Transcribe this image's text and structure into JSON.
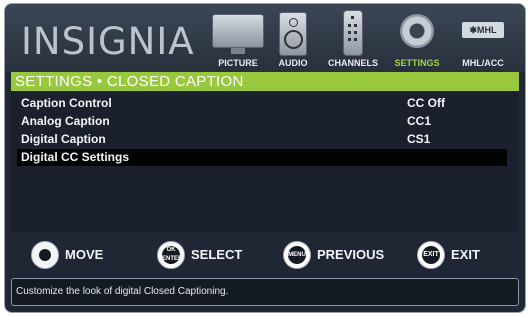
{
  "brand": {
    "logo_text": "INSIGNIA"
  },
  "tabs": [
    {
      "label": "PICTURE",
      "icon": "picture-icon",
      "active": false
    },
    {
      "label": "AUDIO",
      "icon": "audio-speaker-icon",
      "active": false
    },
    {
      "label": "CHANNELS",
      "icon": "remote-control-icon",
      "active": false
    },
    {
      "label": "SETTINGS",
      "icon": "settings-gear-icon",
      "active": true
    },
    {
      "label": "MHL/ACC",
      "icon": "mhl-icon",
      "icon_text": "✱MHL",
      "active": false
    }
  ],
  "header": {
    "title": "SETTINGS • CLOSED CAPTION"
  },
  "menu": {
    "items": [
      {
        "label": "Caption Control",
        "value": "CC Off",
        "selected": false
      },
      {
        "label": "Analog Caption",
        "value": "CC1",
        "selected": false
      },
      {
        "label": "Digital Caption",
        "value": "CS1",
        "selected": false
      },
      {
        "label": "Digital CC Settings",
        "value": "",
        "selected": true
      }
    ]
  },
  "keys": [
    {
      "button": "",
      "label": "MOVE",
      "icon": "dpad-icon"
    },
    {
      "button": "OK ENTER",
      "label": "SELECT",
      "icon": "ok-enter-icon"
    },
    {
      "button": "MENU",
      "label": "PREVIOUS",
      "icon": "menu-icon"
    },
    {
      "button": "EXIT",
      "label": "EXIT",
      "icon": "exit-icon"
    }
  ],
  "help": {
    "text": "Customize the look of digital Closed Captioning."
  },
  "colors": {
    "accent": "#98c83e",
    "background": "#1f2734",
    "selected_row": "#020304"
  }
}
